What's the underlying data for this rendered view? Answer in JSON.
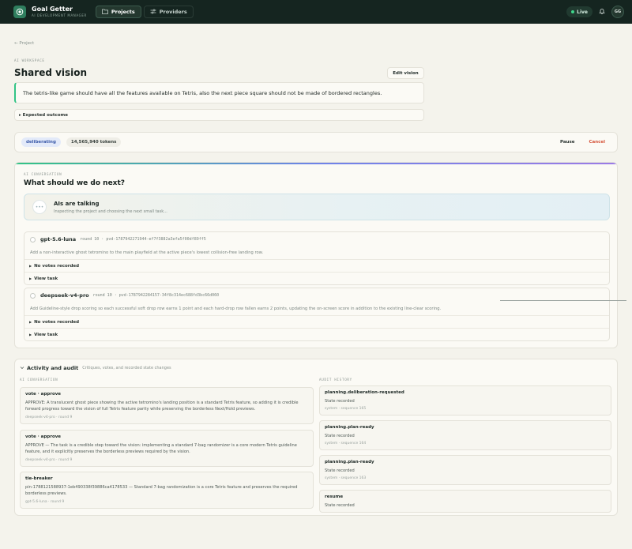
{
  "app": {
    "name": "Goal Getter",
    "subtitle": "AI DEVELOPMENT MANAGER"
  },
  "nav": [
    {
      "label": "Projects",
      "icon": "folder-icon",
      "active": true
    },
    {
      "label": "Providers",
      "icon": "sliders-icon",
      "active": false
    }
  ],
  "topbar": {
    "live_label": "Live",
    "avatar_initials": "GG"
  },
  "header": {
    "breadcrumb": "← Project",
    "eyebrow": "AI WORKSPACE",
    "title": "Shared vision",
    "edit_button": "Edit vision",
    "vision_text": "The tetris-like game should have all the features available on Tetris, also the next piece square should not be made of bordered rectangles.",
    "expected_outcome": "▸ Expected outcome"
  },
  "status": {
    "state": "deliberating",
    "tokens": "14,565,940 tokens",
    "pause_label": "Pause",
    "cancel_label": "Cancel"
  },
  "conversation": {
    "eyebrow": "AI CONVERSATION",
    "title": "What should we do next?",
    "talking_title": "AIs are talking",
    "talking_sub": "Inspecting the project and choosing the next small task...",
    "tasks": [
      {
        "model": "gpt-5.6-luna",
        "meta": "round 10 · pvd-1787942271944-ef7f3882a3efa5f00df89ff5",
        "description": "Add a non-interactive ghost tetromino to the main playfield at the active piece's lowest collision-free landing row.",
        "votes": "No votes recorded",
        "view": "View task"
      },
      {
        "model": "deepseek-v4-pro",
        "meta": "round 10 · pvd-1787942284157-34f8c314ec688fd3bc66d060",
        "description": "Add Guideline-style drop scoring so each successful soft drop row earns 1 point and each hard-drop row fallen earns 2 points, updating the on-screen score in addition to the existing line-clear scoring.",
        "votes": "No votes recorded",
        "view": "View task"
      }
    ]
  },
  "activity": {
    "title": "Activity and audit",
    "subtitle": "Critiques, votes, and recorded state changes",
    "conversation_label": "AI CONVERSATION",
    "audit_label": "AUDIT HISTORY",
    "log": [
      {
        "title": "vote · approve",
        "body": "APPROVE: A translucent ghost piece showing the active tetromino's landing position is a standard Tetris feature, so adding it is credible forward progress toward the vision of full Tetris feature parity while preserving the borderless Next/Hold previews.",
        "meta": "deepseek-v4-pro · round 9"
      },
      {
        "title": "vote · approve",
        "body": "APPROVE — The task is a credible step toward the vision: implementing a standard 7-bag randomizer is a core modern Tetris guideline feature, and it explicitly preserves the borderless previews required by the vision.",
        "meta": "deepseek-v4-pro · round 9"
      },
      {
        "title": "tie-breaker",
        "body": "pin-1788121588937-1eb490338f39886ca4178533 — Standard 7-bag randomization is a core Tetris feature and preserves the required borderless previews.",
        "meta": "gpt-5.6-luna · round 9"
      }
    ],
    "audit": [
      {
        "title": "planning.deliberation-requested",
        "state": "State recorded",
        "meta": "system · sequence 165"
      },
      {
        "title": "planning.plan-ready",
        "state": "State recorded",
        "meta": "system · sequence 164"
      },
      {
        "title": "planning.plan-ready",
        "state": "State recorded",
        "meta": "system · sequence 163"
      },
      {
        "title": "resume",
        "state": "State recorded",
        "meta": ""
      }
    ]
  },
  "colors": {
    "accent": "#33c486",
    "topbar": "#152520",
    "cancel": "#d5533a",
    "state_pill": "#3d5caa"
  }
}
